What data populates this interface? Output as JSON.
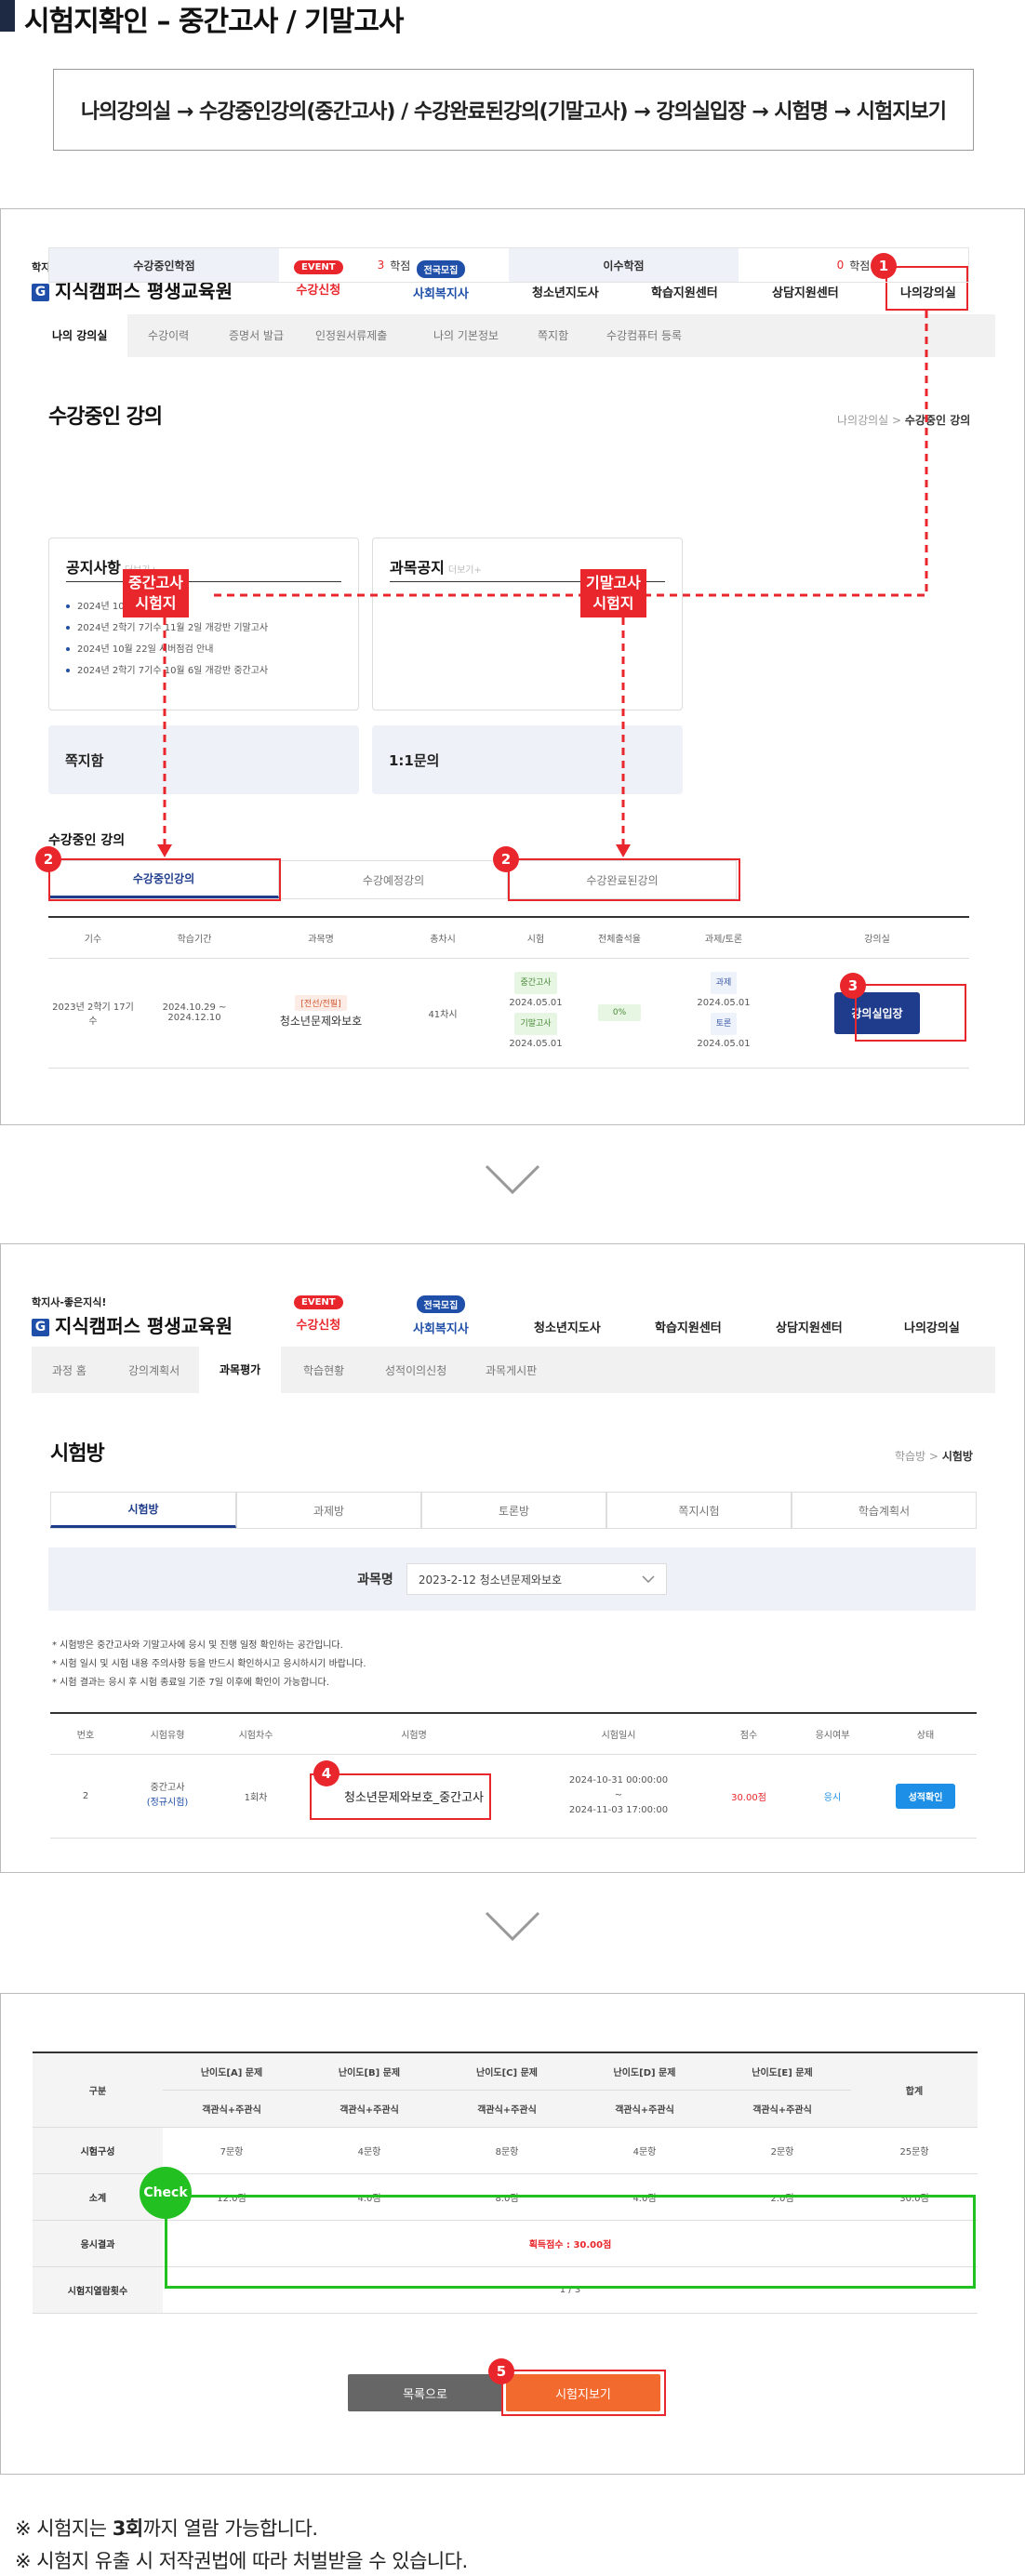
{
  "page_title": "시험지확인 – 중간고사 / 기말고사",
  "path_steps": "나의강의실 → 수강중인강의(중간고사) / 수강완료된강의(기말고사) → 강의실입장 → 시험명 → 시험지보기",
  "site": {
    "logo_small": "학지사-좋은지식!",
    "logo_main": "지식캠퍼스 평생교육원",
    "logo_letter": "G",
    "nav": [
      {
        "badge": "EVENT",
        "label": "수강신청"
      },
      {
        "badge": "전국모집",
        "label": "사회복지사"
      },
      {
        "label": "청소년지도사"
      },
      {
        "label": "학습지원센터"
      },
      {
        "label": "상담지원센터"
      },
      {
        "label": "나의강의실"
      }
    ]
  },
  "panel1": {
    "subnav": [
      "나의 강의실",
      "수강이력",
      "증명서 발급",
      "인정원서류제출",
      "나의 기본정보",
      "쪽지함",
      "수강컴퓨터 등록"
    ],
    "heading": "수강중인 강의",
    "crumb_root": "나의강의실 > ",
    "crumb_current": "수강중인 강의",
    "credits": {
      "in_progress_label": "수강중인학점",
      "in_progress_value": "3",
      "unit": "학점",
      "completed_label": "이수학점",
      "completed_value": "0"
    },
    "notice_title": "공지사항",
    "more": "더보기+",
    "notices": [
      "2024년 10월 ...",
      "2024년 2학기 7기수 11월 2일 개강반 기말고사",
      "2024년 10월 22일 서버점검 안내",
      "2024년 2학기 7기수 10월 6일 개강반 중간고사"
    ],
    "subject_notice_title": "과목공지",
    "card_message": "쪽지함",
    "card_qna": "1:1문의",
    "section_label": "수강중인 강의",
    "tabs": [
      "수강중인강의",
      "수강예정강의",
      "수강완료된강의"
    ],
    "columns": [
      "기수",
      "학습기간",
      "과목명",
      "총차시",
      "시험",
      "전체출석율",
      "과제/토론",
      "강의실"
    ],
    "row": {
      "term": "2023년 2학기 17기수",
      "period": "2024.10.29 ~ 2024.12.10",
      "tag": "[전선/전필]",
      "course": "청소년문제와보호",
      "sessions": "41차시",
      "exam_mid_label": "중간고사",
      "exam_mid_date": "2024.05.01",
      "exam_final_label": "기말고사",
      "exam_final_date": "2024.05.01",
      "attendance": "0%",
      "task_label": "과제",
      "task_date": "2024.05.01",
      "discussion_label": "토론",
      "discussion_date": "2024.05.01",
      "enter_button": "강의실입장"
    },
    "tag_mid": "중간고사\n시험지",
    "tag_final": "기말고사\n시험지"
  },
  "panel2": {
    "subnav": [
      "과정 홈",
      "강의계획서",
      "과목평가",
      "학습현황",
      "성적이의신청",
      "과목게시판"
    ],
    "heading": "시험방",
    "crumb_root": "학습방 > ",
    "crumb_current": "시험방",
    "tabs": [
      "시험방",
      "과제방",
      "토론방",
      "쪽지시험",
      "학습계획서"
    ],
    "filter_label": "과목명",
    "filter_value": "2023-2-12 청소년문제와보호",
    "guides": [
      "* 시험방은 중간고사와 기말고사에 응시 및 진행 일정 확인하는 공간입니다.",
      "* 시험 일시 및 시험 내용 주의사항 등을 반드시 확인하시고 응시하시기 바랍니다.",
      "* 시험 결과는 응시 후 시험 종료일 기준 7일 이후에 확인이 가능합니다."
    ],
    "columns": [
      "번호",
      "시험유형",
      "시험차수",
      "시험명",
      "시험일시",
      "점수",
      "응시여부",
      "상태"
    ],
    "row": {
      "no": "2",
      "type": "중간고사",
      "type_sub": "(정규시험)",
      "round": "1회차",
      "name": "청소년문제와보호_중간고사",
      "start": "2024-10-31 00:00:00",
      "tilde": "~",
      "end": "2024-11-03 17:00:00",
      "score": "30.00점",
      "taken": "응시",
      "status_button": "성적확인"
    }
  },
  "panel3": {
    "col_first": "구분",
    "levels": [
      "난이도[A] 문제",
      "난이도[B] 문제",
      "난이도[C] 문제",
      "난이도[D] 문제",
      "난이도[E] 문제"
    ],
    "level_sub": "객관식+주관식",
    "col_total": "합계",
    "rows": [
      {
        "label": "시험구성",
        "values": [
          "7문항",
          "4문항",
          "8문항",
          "4문항",
          "2문항",
          "25문항"
        ]
      },
      {
        "label": "소계",
        "values": [
          "12.0점",
          "4.0점",
          "8.0점",
          "4.0점",
          "2.0점",
          "30.0점"
        ]
      }
    ],
    "result_label": "응시결과",
    "result_value": "획득점수 : 30.00점",
    "views_label": "시험지열람횟수",
    "views_value": "1 / 3",
    "check": "Check",
    "btn_list": "목록으로",
    "btn_view": "시험지보기"
  },
  "notes": {
    "line1_prefix": "※ 시험지는 ",
    "line1_bold": "3회",
    "line1_suffix": "까지 열람 가능합니다.",
    "line2": "※ 시험지 유출 시 저작권법에 따라 처벌받을 수 있습니다."
  },
  "steps": [
    "1",
    "2",
    "2",
    "3",
    "4",
    "5"
  ],
  "colors": {
    "accent_red": "#e8262b",
    "navy": "#1f3c8c",
    "orange": "#f26a2e",
    "check_green": "#22c021"
  }
}
